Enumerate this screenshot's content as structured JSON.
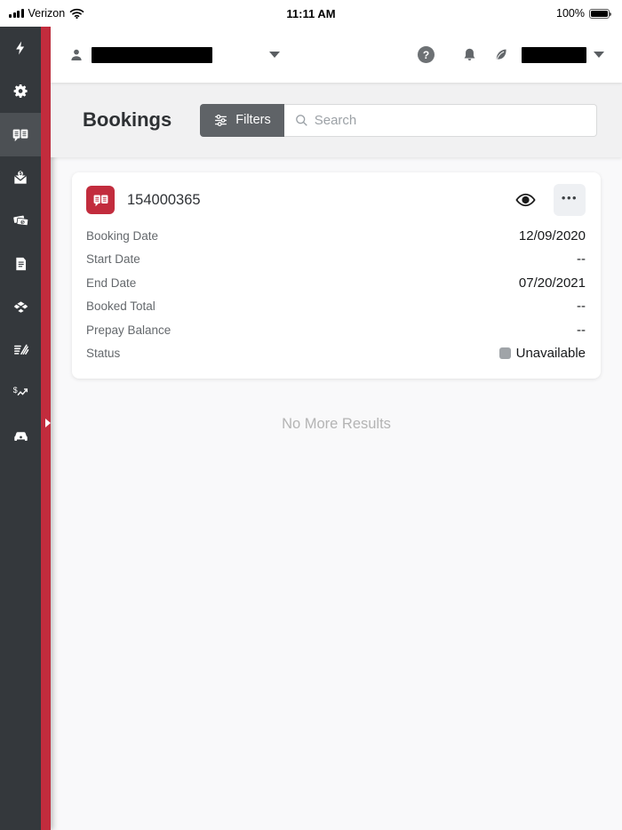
{
  "status_bar": {
    "carrier": "Verizon",
    "time": "11:11 AM",
    "battery_percent": "100%"
  },
  "header": {
    "help_glyph": "?"
  },
  "sidebar": {
    "accent_color": "#c22c3d",
    "items": [
      {
        "icon": "flash-icon"
      },
      {
        "icon": "gear-icon"
      },
      {
        "icon": "bookings-book-icon",
        "active": true
      },
      {
        "icon": "invoice-envelope-icon"
      },
      {
        "icon": "cash-icon"
      },
      {
        "icon": "document-icon"
      },
      {
        "icon": "open-box-icon"
      },
      {
        "icon": "reports-stripes-icon"
      },
      {
        "icon": "money-trend-icon"
      },
      {
        "icon": "car-icon"
      }
    ]
  },
  "page": {
    "title": "Bookings",
    "filters_label": "Filters",
    "search_placeholder": "Search"
  },
  "booking_card": {
    "id": "154000365",
    "more_glyph": "•••",
    "fields": [
      {
        "label": "Booking Date",
        "value": "12/09/2020"
      },
      {
        "label": "Start Date",
        "value": "--"
      },
      {
        "label": "End Date",
        "value": "07/20/2021"
      },
      {
        "label": "Booked Total",
        "value": "--"
      },
      {
        "label": "Prepay Balance",
        "value": "--"
      },
      {
        "label": "Status",
        "value": "Unavailable",
        "status_color": "#a0a4a8"
      }
    ]
  },
  "footer": {
    "no_more_results": "No More Results"
  }
}
